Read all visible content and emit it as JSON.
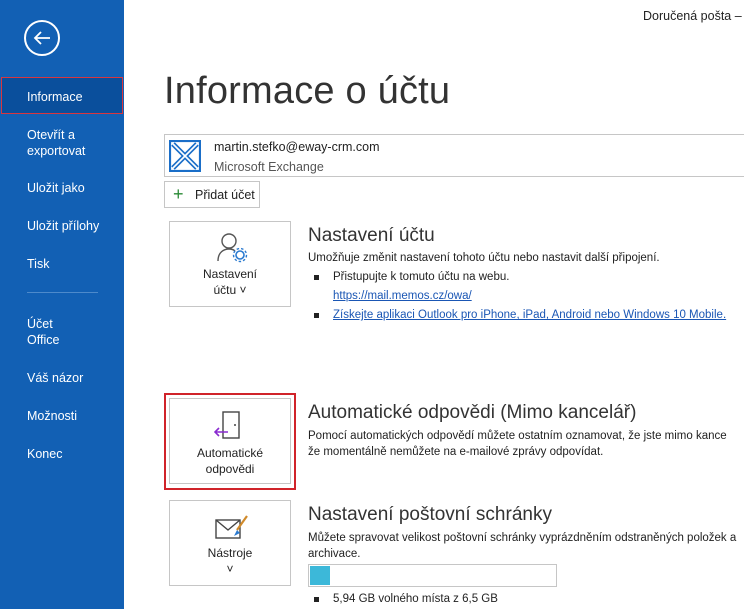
{
  "window": {
    "title": "Doručená pošta –"
  },
  "sidebar": {
    "items": [
      {
        "label": "Informace"
      },
      {
        "label": "Otevřít a exportovat"
      },
      {
        "label": "Uložit jako"
      },
      {
        "label": "Uložit přílohy"
      },
      {
        "label": "Tisk"
      },
      {
        "label": "Účet Office"
      },
      {
        "label": "Váš názor"
      },
      {
        "label": "Možnosti"
      },
      {
        "label": "Konec"
      }
    ]
  },
  "page": {
    "title": "Informace o účtu"
  },
  "account": {
    "email": "martin.stefko@eway-crm.com",
    "type": "Microsoft Exchange",
    "add_label": "Přidat účet"
  },
  "settings": {
    "tile_label_1": "Nastavení",
    "tile_label_2": "účtu ˅",
    "title": "Nastavení účtu",
    "desc": "Umožňuje změnit nastavení tohoto účtu nebo nastavit další připojení.",
    "bullet1": "Přistupujte k tomuto účtu na webu.",
    "link1": "https://mail.memos.cz/owa/",
    "link2": "Získejte aplikaci Outlook pro iPhone, iPad, Android nebo Windows 10 Mobile."
  },
  "auto_reply": {
    "tile_label_1": "Automatické",
    "tile_label_2": "odpovědi",
    "title": "Automatické odpovědi (Mimo kancelář)",
    "desc1": "Pomocí automatických odpovědí můžete ostatním oznamovat, že jste mimo kance",
    "desc2": "že momentálně nemůžete na e-mailové zprávy odpovídat."
  },
  "mailbox": {
    "tile_label_1": "Nástroje",
    "tile_label_2": "˅",
    "title": "Nastavení poštovní schránky",
    "desc1": "Můžete spravovat velikost poštovní schránky vyprázdněním odstraněných položek a",
    "desc2": "archivace.",
    "usage_fraction": 0.08,
    "free_space": "5,94 GB volného místa z 6,5 GB"
  },
  "colors": {
    "sidebar": "#1260b4",
    "accent_red": "#d0232a",
    "link": "#1a56b4",
    "progress": "#3cb8d9"
  },
  "icons": {
    "back": "back-arrow-icon",
    "exchange": "exchange-logo-icon",
    "account_settings": "user-gear-icon",
    "auto_reply": "door-arrow-icon",
    "tools": "mail-brush-icon"
  }
}
